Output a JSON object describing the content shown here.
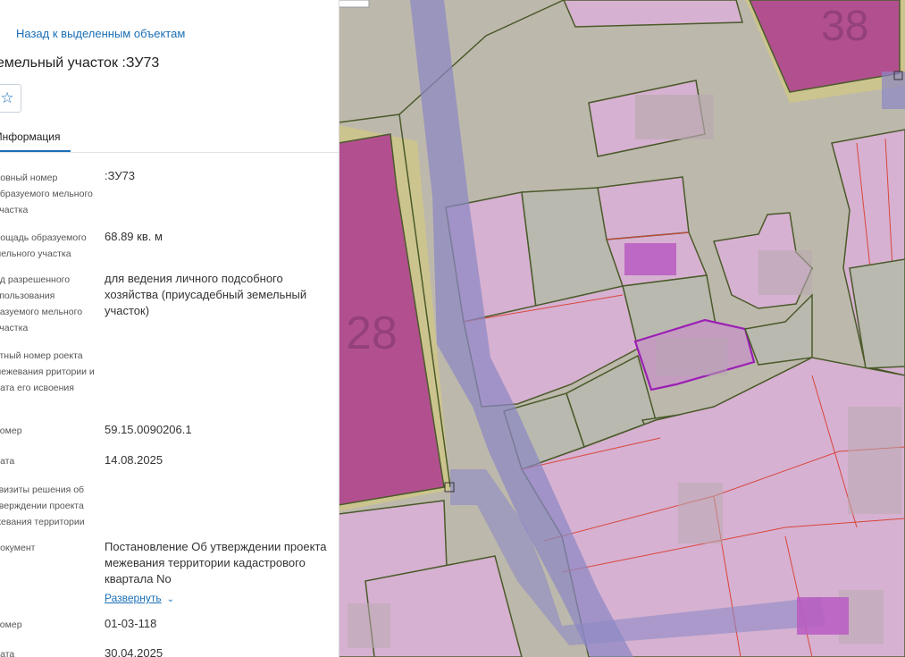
{
  "panel": {
    "back_label": "Назад к выделенным объектам",
    "title": "емельный участок :ЗУ73",
    "tab_info": "Информация",
    "rows": [
      {
        "label": "ловный номер образуемого мельного участка",
        "value": ":ЗУ73"
      },
      {
        "label": "лощадь образуемого мельного участка",
        "value": "68.89 кв. м"
      },
      {
        "label": "ид разрешенного спользования разуемого мельного участка",
        "value": "для ведения личного подсобного хозяйства (приусадебный земельный участок)"
      },
      {
        "label": "етный номер роекта межевания рритории и дата его исвоения",
        "value": ""
      },
      {
        "label": "номер",
        "value": "59.15.0090206.1"
      },
      {
        "label": "дата",
        "value": "14.08.2025"
      },
      {
        "label": "квизиты решения об тверждении проекта жевания территории",
        "value": ""
      },
      {
        "label": "документ",
        "value": "Постановление Об утверждении проекта межевания территории кадастрового квартала No"
      },
      {
        "label": "номер",
        "value": "01-03-118"
      },
      {
        "label": "дата",
        "value": "30.04.2025"
      }
    ],
    "expand_label": "Развернуть"
  },
  "map": {
    "parcel_labels": [
      "38",
      "28"
    ],
    "colors": {
      "base": "#bdb8ac",
      "parcel_pink": "#d8b3d3",
      "parcel_magenta": "#b2508f",
      "gray_parcel": "#b9b9af",
      "road_blue": "#8c88c4",
      "selected_outline": "#9b1fb5",
      "boundary_green": "#4a5a2a",
      "boundary_red": "#d9463c"
    }
  }
}
